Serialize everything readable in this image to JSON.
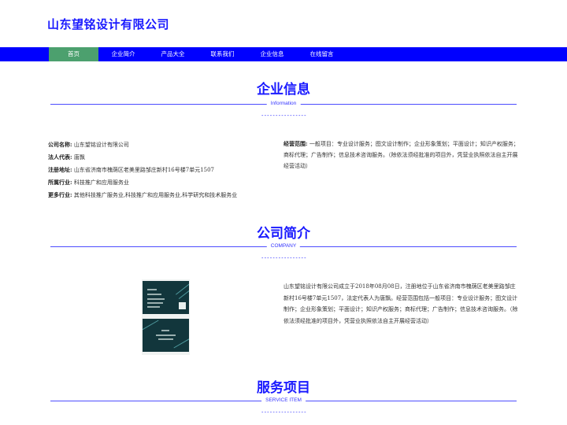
{
  "header": {
    "logo": "山东望铭设计有限公司"
  },
  "nav": {
    "items": [
      {
        "label": "首页",
        "active": true
      },
      {
        "label": "企业简介",
        "active": false
      },
      {
        "label": "产品大全",
        "active": false
      },
      {
        "label": "联系我们",
        "active": false
      },
      {
        "label": "企业信息",
        "active": false
      },
      {
        "label": "在线留言",
        "active": false
      }
    ]
  },
  "sections": {
    "info": {
      "title": "企业信息",
      "subtitle": "Information",
      "dash": "----------------"
    },
    "about": {
      "title": "公司简介",
      "subtitle": "COMPANY",
      "dash": "----------------"
    },
    "service": {
      "title": "服务项目",
      "subtitle": "SERVICE ITEM",
      "dash": "----------------"
    }
  },
  "company_info": {
    "rows": [
      {
        "key": "公司名称:",
        "value": "山东望铭设计有限公司"
      },
      {
        "key": "法人代表:",
        "value": "唐飘"
      },
      {
        "key": "注册地址:",
        "value": "山东省济南市槐荫区老美里路邹庄新村16号楼7单元1507"
      },
      {
        "key": "所属行业:",
        "value": "科技推广和应用服务业"
      },
      {
        "key": "更多行业:",
        "value": "其他科技推广服务业,科技推广和应用服务业,科学研究和技术服务业"
      }
    ],
    "scope": {
      "key": "经营范围:",
      "value": "一般项目：专业设计服务；图文设计制作；企业形象策划；平面设计；知识产权服务；商标代理；广告制作；信息技术咨询服务。（除依法须经批准的项目外，凭营业执照依法自主开展经营活动）"
    }
  },
  "about": {
    "text": "山东望铭设计有限公司成立于2018年08月08日，注册地位于山东省济南市槐荫区老美里路邹庄新村16号楼7单元1507，法定代表人为唐飘。经营范围包括一般项目：专业设计服务；图文设计制作；企业形象策划；平面设计；知识产权服务；商标代理；广告制作；信息技术咨询服务。（除依法须经批准的项目外，凭营业执照依法自主开展经营活动）"
  },
  "colors": {
    "brand": "#1a1aff",
    "nav_bg": "#0000ff",
    "nav_active": "#4ca06e",
    "card": "#12363c"
  }
}
